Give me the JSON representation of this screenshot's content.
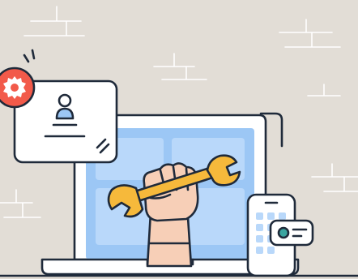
{
  "illustration": {
    "subject": "",
    "colors": {
      "background": "#e2ddd6",
      "screen": "#9cc7f5",
      "screen_tile": "#b9d8fa",
      "laptop_body": "#ffffff",
      "wrench": "#f6b93b",
      "skin": "#f7cfb7",
      "gear_badge": "#f25a4a",
      "toggle_accent": "#3aa5a0",
      "outline": "#1f2a3a"
    },
    "icons": [
      "gear-icon",
      "user-icon",
      "wrench-icon",
      "fist-icon",
      "laptop-icon",
      "smartphone-icon",
      "toggle-icon"
    ]
  }
}
